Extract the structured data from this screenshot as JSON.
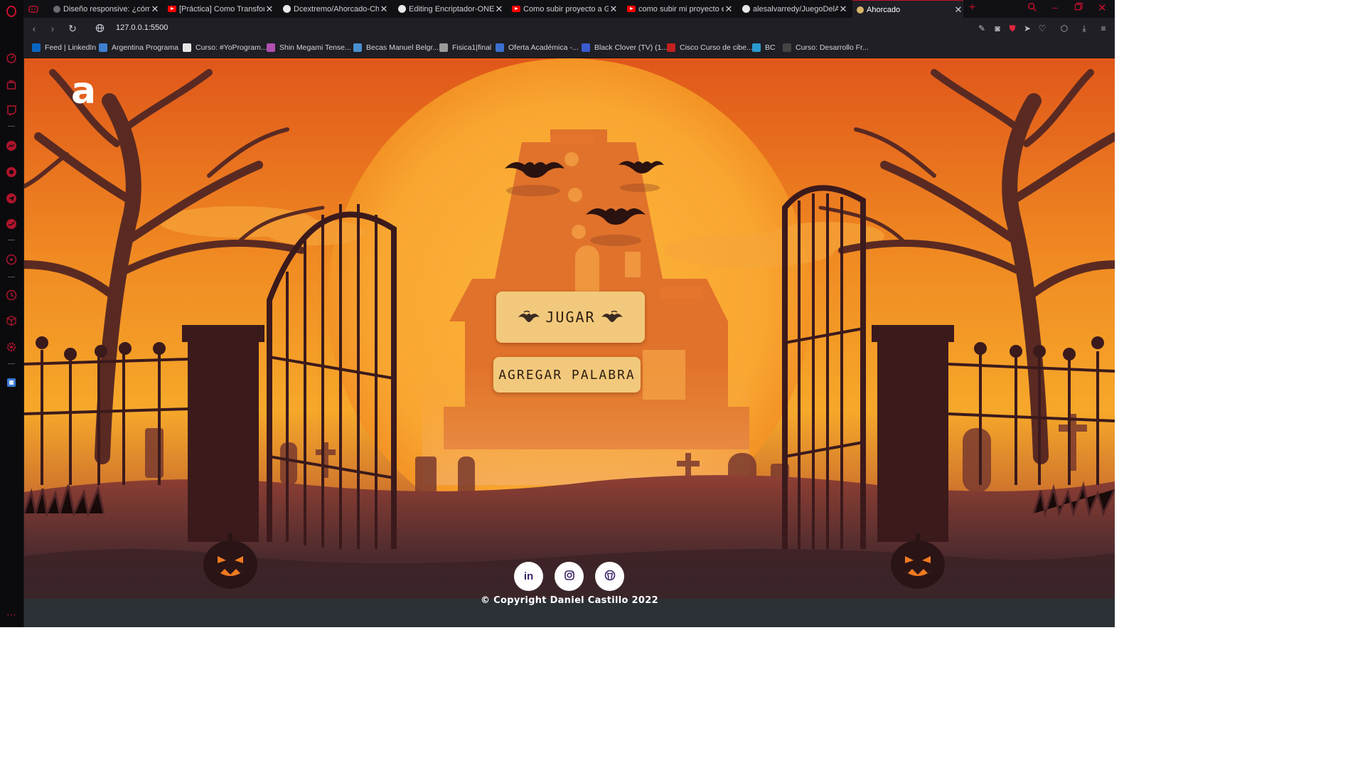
{
  "browser": {
    "tabs": [
      {
        "title": "Diseño responsive: ¿cómo",
        "favicon": "page-icon"
      },
      {
        "title": "[Práctica] Como Transforma",
        "favicon": "youtube-icon"
      },
      {
        "title": "Dcextremo/Ahorcado-Chal",
        "favicon": "github-icon"
      },
      {
        "title": "Editing Encriptador-ONE/R",
        "favicon": "github-icon"
      },
      {
        "title": "Como subir proyecto a Git",
        "favicon": "youtube-icon"
      },
      {
        "title": "como subir mi proyecto en",
        "favicon": "youtube-icon"
      },
      {
        "title": "alesalvarredy/JuegoDelAho",
        "favicon": "github-icon"
      },
      {
        "title": "Ahorcado",
        "favicon": "page-icon",
        "active": true
      }
    ],
    "new_tab_label": "+",
    "url": "127.0.0.1:5500",
    "bookmarks": [
      {
        "label": "Feed | LinkedIn",
        "color": "#0a66c2"
      },
      {
        "label": "Argentina Programa",
        "color": "#3f7fd0"
      },
      {
        "label": "Curso: #YoProgram...",
        "color": "#e6e6e6"
      },
      {
        "label": "Shin Megami Tense...",
        "color": "#b04fb0"
      },
      {
        "label": "Becas Manuel Belgr...",
        "color": "#4a8fd0"
      },
      {
        "label": "Fisica1|final",
        "color": "#9a9a9a"
      },
      {
        "label": "Oferta Académica -...",
        "color": "#3a6fd0"
      },
      {
        "label": "Black Clover (TV) (1...",
        "color": "#3b5bd0"
      },
      {
        "label": "Cisco Curso de cibe...",
        "color": "#c02020"
      },
      {
        "label": "BC",
        "color": "#2a9ad0"
      },
      {
        "label": "Curso: Desarrollo Fr...",
        "color": "#444444"
      }
    ]
  },
  "page": {
    "logo": "a",
    "play_label": "JUGAR",
    "add_word_label": "AGREGAR PALABRA",
    "social": [
      {
        "name": "linkedin",
        "glyph": "in"
      },
      {
        "name": "instagram",
        "glyph": "◎"
      },
      {
        "name": "github",
        "glyph": "●"
      }
    ],
    "copyright": "© Copyright Daniel Castillo 2022"
  },
  "colors": {
    "accent_red": "#c8102e",
    "sky_top": "#e05a1a",
    "sky_mid": "#f39a25",
    "button_bg": "#f2c97c"
  }
}
